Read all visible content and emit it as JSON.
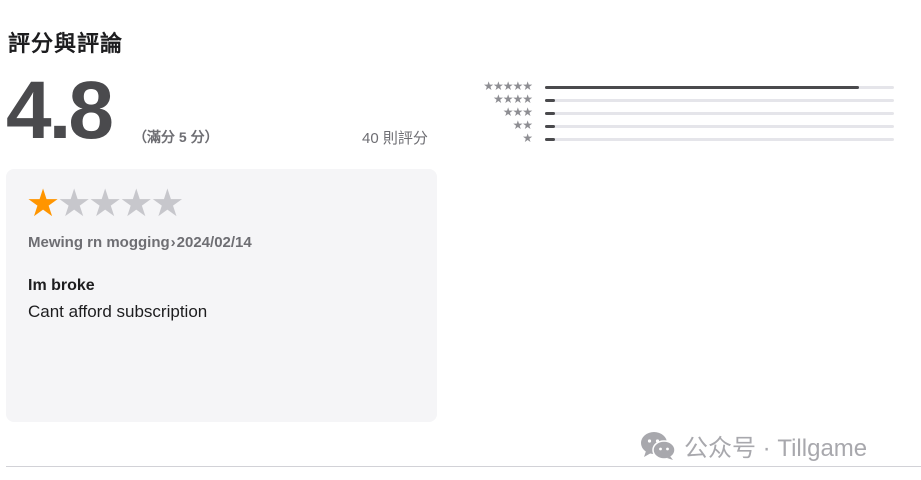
{
  "ratings": {
    "section_title": "評分與評論",
    "score": "4.8",
    "out_of": "（滿分 5 分）",
    "count_text": "40 則評分",
    "histogram": [
      {
        "stars": "★★★★★",
        "fraction": 0.9
      },
      {
        "stars": "★★★★",
        "fraction": 0.03
      },
      {
        "stars": "★★★",
        "fraction": 0.03
      },
      {
        "stars": "★★",
        "fraction": 0.03
      },
      {
        "stars": "★",
        "fraction": 0.03
      }
    ],
    "bar_color": "#4a4a4d",
    "track_color": "#e5e5ea"
  },
  "review": {
    "star_rating": 1,
    "star_max": 5,
    "star_on_color": "#ff9500",
    "star_off_color": "#c7c7cc",
    "author": "Mewing rn mogging",
    "separator": "›",
    "date": "2024/02/14",
    "title": "Im broke",
    "body": "Cant afford subscription"
  },
  "watermark": {
    "icon": "wechat-icon",
    "text": "公众号 · Tillgame"
  }
}
